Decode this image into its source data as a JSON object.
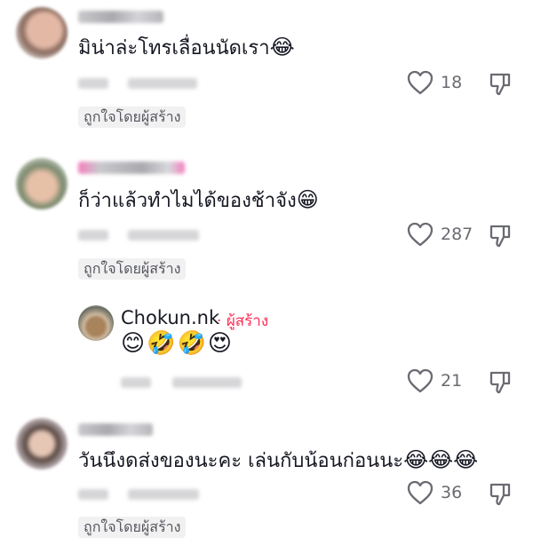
{
  "comments": [
    {
      "text": "มิน่าล่ะโทรเลื่อนนัดเรา",
      "emoji": "😂",
      "likes": "18",
      "badge": "ถูกใจโดยผู้สร้าง"
    },
    {
      "text": "ก็ว่าแล้วทำไมได้ของช้าจัง",
      "emoji": "😁",
      "likes": "287",
      "badge": "ถูกใจโดยผู้สร้าง"
    },
    {
      "text": "วันนึงดส่งของนะคะ เล่นกับน้อนก่อนนะ",
      "emoji": "😂😂😂",
      "likes": "36",
      "badge": "ถูกใจโดยผู้สร้าง"
    }
  ],
  "reply": {
    "username": "Chokun.nk",
    "separator": "·",
    "creator_label": "ผู้สร้าง",
    "emojis": "😊🤣🤣😍",
    "likes": "21"
  },
  "colors": {
    "creator": "#fe2c55",
    "meta": "#6a6b72",
    "badge_bg": "#f1f1f2"
  },
  "icons": {
    "like": "heart-outline-icon",
    "dislike": "thumbs-down-outline-icon"
  }
}
